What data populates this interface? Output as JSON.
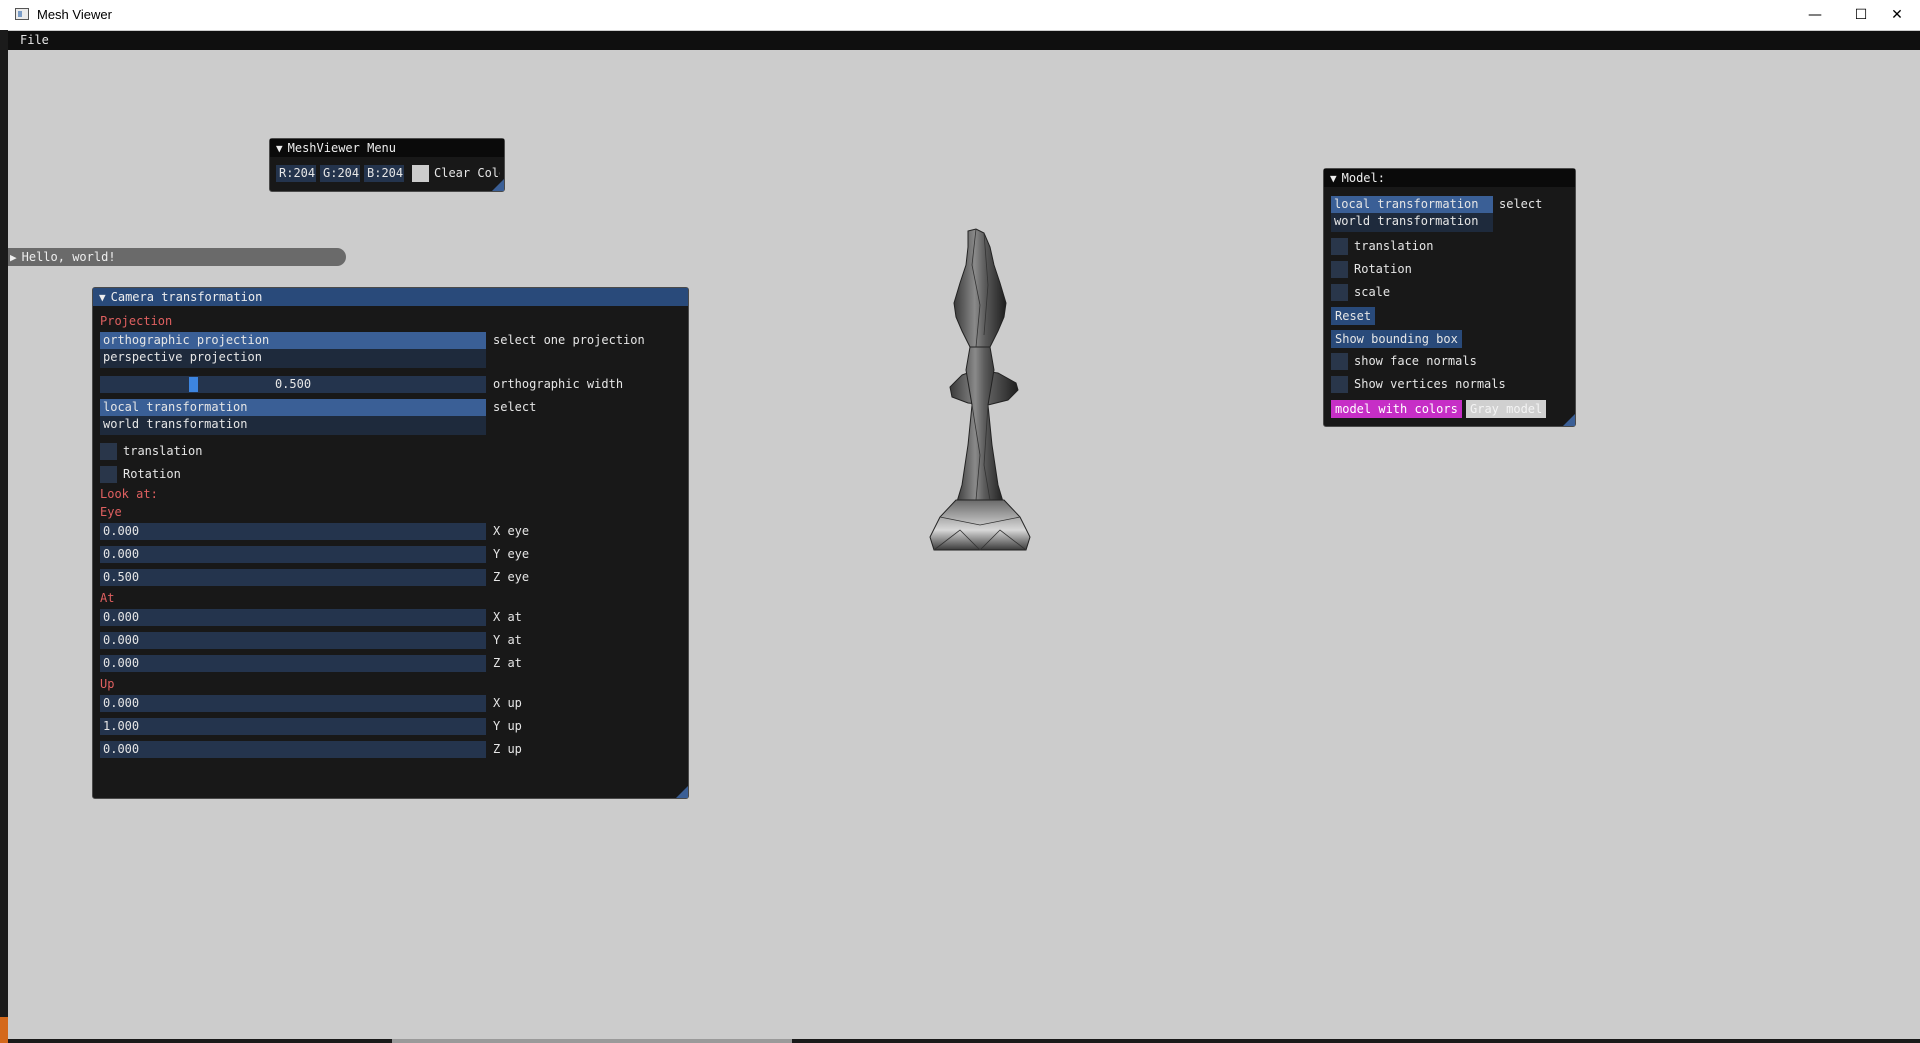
{
  "window": {
    "title": "Mesh Viewer",
    "minimize": "—",
    "maximize": "☐",
    "close": "✕"
  },
  "menubar": {
    "file": "File"
  },
  "meshviewer_menu": {
    "title": "MeshViewer Menu",
    "r": "R:204",
    "g": "G:204",
    "b": "B:204",
    "swatch_color": "#cccccc",
    "clear_label": "Clear Colo"
  },
  "hello": {
    "title": "Hello, world!"
  },
  "camera": {
    "title": "Camera transformation",
    "projection_heading": "Projection",
    "projections": [
      "orthographic projection",
      "perspective projection"
    ],
    "projection_label": "select one projection",
    "ortho_width_value": "0.500",
    "ortho_width_fraction": 0.5,
    "ortho_width_label": "orthographic width",
    "transforms": [
      "local transformation",
      "world transformation"
    ],
    "transform_label": "select",
    "translation_label": "translation",
    "rotation_label": "Rotation",
    "lookat_heading": "Look at:",
    "eye_heading": "Eye",
    "eye": [
      {
        "value": "0.000",
        "label": "X eye"
      },
      {
        "value": "0.000",
        "label": "Y eye"
      },
      {
        "value": "0.500",
        "label": "Z eye"
      }
    ],
    "at_heading": "At",
    "at": [
      {
        "value": "0.000",
        "label": "X at"
      },
      {
        "value": "0.000",
        "label": "Y at"
      },
      {
        "value": "0.000",
        "label": "Z at"
      }
    ],
    "up_heading": "Up",
    "up": [
      {
        "value": "0.000",
        "label": "X up"
      },
      {
        "value": "1.000",
        "label": "Y up"
      },
      {
        "value": "0.000",
        "label": "Z up"
      }
    ]
  },
  "model": {
    "title": "Model:",
    "transforms": [
      "local transformation",
      "world transformation"
    ],
    "select_label": "select",
    "translation_label": "translation",
    "rotation_label": "Rotation",
    "scale_label": "scale",
    "reset_label": "Reset",
    "bbox_label": "Show bounding box",
    "face_normals_label": "show face normals",
    "vertex_normals_label": "Show vertices normals",
    "colors_label": "model with colors",
    "gray_label": "Gray model",
    "colors_btn_color": "#c62ec6",
    "gray_btn_color": "#d0d0d0"
  }
}
